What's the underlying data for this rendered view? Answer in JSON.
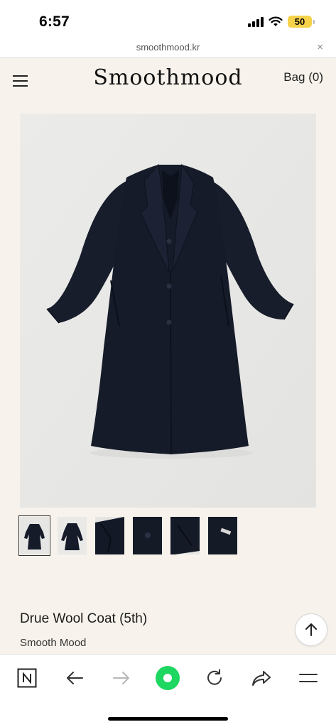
{
  "status_bar": {
    "time": "6:57",
    "battery": "50"
  },
  "browser": {
    "url": "smoothmood.kr",
    "close_symbol": "×"
  },
  "header": {
    "logo": "Smoothmood",
    "bag_label": "Bag (0)"
  },
  "gallery": {
    "main_image_alt": "navy wool coat",
    "thumbnails": [
      {
        "name": "coat-front",
        "active": true
      },
      {
        "name": "coat-front-alt",
        "active": false
      },
      {
        "name": "collar-detail",
        "active": false
      },
      {
        "name": "button-detail",
        "active": false
      },
      {
        "name": "pocket-detail",
        "active": false
      },
      {
        "name": "label-detail",
        "active": false
      }
    ]
  },
  "product": {
    "title": "Drue Wool Coat (5th)",
    "brand": "Smooth Mood"
  },
  "colors": {
    "page_bg": "#f7f3ec",
    "coat": "#161b2a",
    "accent_green": "#1ed760"
  },
  "bottom_nav": [
    {
      "icon": "naver-n-icon"
    },
    {
      "icon": "back-arrow-icon"
    },
    {
      "icon": "forward-arrow-icon"
    },
    {
      "icon": "green-dot-icon"
    },
    {
      "icon": "refresh-icon"
    },
    {
      "icon": "share-icon"
    },
    {
      "icon": "menu-lines-icon"
    }
  ]
}
